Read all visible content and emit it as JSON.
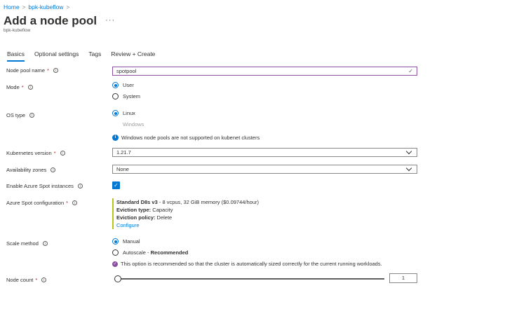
{
  "breadcrumb": {
    "home": "Home",
    "cluster": "bpk-kubeflow"
  },
  "page": {
    "title": "Add a node pool",
    "subtitle": "bpk-kubeflow",
    "more": "···"
  },
  "tabs": [
    "Basics",
    "Optional settings",
    "Tags",
    "Review + Create"
  ],
  "form": {
    "node_pool_name": {
      "label": "Node pool name",
      "value": "spotpool"
    },
    "mode": {
      "label": "Mode",
      "options": [
        "User",
        "System"
      ],
      "selected": "User"
    },
    "os_type": {
      "label": "OS type",
      "options": [
        "Linux",
        "Windows"
      ],
      "selected": "Linux",
      "note": "Windows node pools are not supported on kubenet clusters"
    },
    "kubernetes_version": {
      "label": "Kubernetes version",
      "value": "1.21.7"
    },
    "availability_zones": {
      "label": "Availability zones",
      "value": "None"
    },
    "enable_spot": {
      "label": "Enable Azure Spot instances",
      "checked": true
    },
    "spot_config": {
      "label": "Azure Spot configuration",
      "size_name": "Standard D8s v3",
      "size_detail": " - 8 vcpus, 32 GiB memory ($0.09744/hour)",
      "eviction_type_label": "Eviction type:",
      "eviction_type": " Capacity",
      "eviction_policy_label": "Eviction policy:",
      "eviction_policy": " Delete",
      "configure_link": "Configure"
    },
    "scale_method": {
      "label": "Scale method",
      "options": [
        "Manual",
        "Autoscale - "
      ],
      "recommended": "Recommended",
      "selected": "Manual",
      "note": "This option is recommended so that the cluster is automatically sized correctly for the current running workloads."
    },
    "node_count": {
      "label": "Node count",
      "value": "1",
      "slider_fraction": 0.0
    }
  },
  "colors": {
    "accent": "#0078d4",
    "required": "#a4262c",
    "spot_bar": "#b6c61a",
    "active_border": "#8a4f9f"
  }
}
